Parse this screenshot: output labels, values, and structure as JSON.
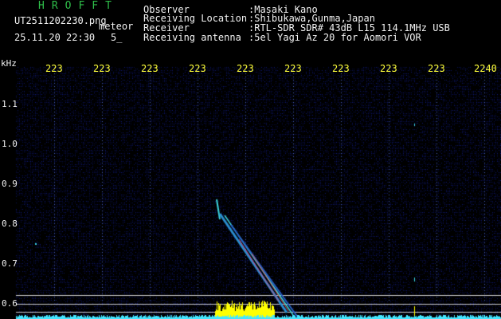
{
  "header": {
    "brand": "HROFFT",
    "filename": "UT2511202230.png",
    "tag": "meteor",
    "datetime": "25.11.20 22:30",
    "interval": "5_",
    "fields": [
      {
        "label": "Observer",
        "value": ":Masaki Kano"
      },
      {
        "label": "Receiving Location",
        "value": ":Shibukawa,Gunma,Japan"
      },
      {
        "label": "Receiver",
        "value": ":RTL-SDR SDR# 43dB L15 114.1MHz USB"
      },
      {
        "label": "Receiving antenna",
        "value": ":5el Yagi Az 20 for Aomori VOR"
      }
    ]
  },
  "xaxis": {
    "ticks": [
      "223",
      "223",
      "223",
      "223",
      "223",
      "223",
      "223",
      "223",
      "223",
      "2240"
    ]
  },
  "yaxis": {
    "unit": "kHz",
    "ticks": [
      "1.1",
      "1.0",
      "0.9",
      "0.8",
      "0.7",
      "0.6"
    ]
  },
  "colors": {
    "background": "#000000",
    "noise": "#0d1a6b",
    "trail": "#3bd6e0",
    "signal_yellow": "#ffff00",
    "baseline_cyan": "#44e6ff",
    "hline": "#c8c8c8"
  }
}
